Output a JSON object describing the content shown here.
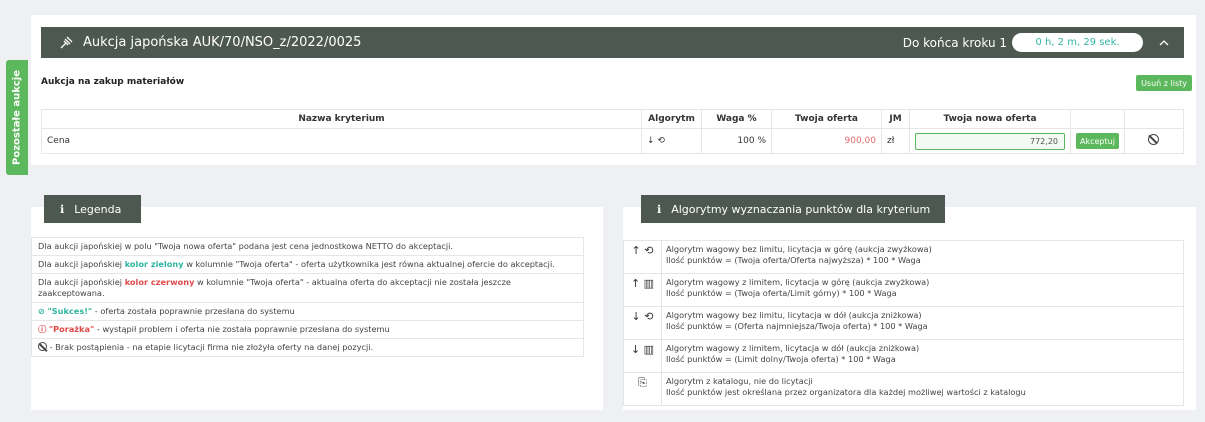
{
  "side_tab": {
    "label": "Pozostałe aukcje"
  },
  "auction": {
    "title": "Aukcja japońska AUK/70/NSO_z/2022/0025",
    "step_label": "Do końca kroku 1",
    "timer": "0 h, 2 m, 29 sek.",
    "subtitle": "Aukcja na zakup materiałów",
    "remove_button": "Usuń z listy",
    "table": {
      "headers": [
        "Nazwa kryterium",
        "Algorytm",
        "Waga %",
        "Twoja oferta",
        "JM",
        "Twoja nowa oferta"
      ],
      "row": {
        "name": "Cena",
        "algorithm_icon": "↓ ⟲",
        "weight": "100 %",
        "offer": "900,00",
        "unit": "zł",
        "new_offer": "772,20",
        "accept_button": "Akceptuj"
      }
    }
  },
  "legend": {
    "title": "Legenda",
    "items": {
      "i1": "Dla aukcji japońskiej w polu \"Twoja nowa oferta\" podana jest cena jednostkowa NETTO do akceptacji.",
      "i2_pre": "Dla aukcji japońskiej ",
      "i2_hl": "kolor zielony",
      "i2_post": " w kolumnie \"Twoja oferta\" - oferta użytkownika jest równa aktualnej ofercie do akceptacji.",
      "i3_pre": "Dla aukcji japońskiej ",
      "i3_hl": "kolor czerwony",
      "i3_post": " w kolumnie \"Twoja oferta\" - aktualna oferta do akceptacji nie została jeszcze zaakceptowana.",
      "i4_hl": "\"Sukces!\"",
      "i4_post": " - oferta została poprawnie przesłana do systemu",
      "i5_hl": "\"Porażka\"",
      "i5_post": " - wystąpił problem i oferta nie została poprawnie przesłana do systemu",
      "i6": " - Brak postąpienia - na etapie licytacji firma nie złożyła oferty na danej pozycji."
    }
  },
  "algorithms": {
    "title": "Algorytmy wyznaczania punktów dla kryterium",
    "items": [
      {
        "icon": "↑ ⟲",
        "line1": "Algorytm wagowy bez limitu, licytacja w górę (aukcja zwyżkowa)",
        "line2": "Ilość punktów = (Twoja oferta/Oferta najwyższa) * 100 * Waga"
      },
      {
        "icon": "↑ ▥",
        "line1": "Algorytm wagowy z limitem, licytacja w górę (aukcja zwyżkowa)",
        "line2": "Ilość punktów = (Twoja oferta/Limit górny) * 100 * Waga"
      },
      {
        "icon": "↓ ⟲",
        "line1": "Algorytm wagowy bez limitu, licytacja w dół (aukcja zniżkowa)",
        "line2": "Ilość punktów = (Oferta najmniejsza/Twoja oferta) * 100 * Waga"
      },
      {
        "icon": "↓ ▥",
        "line1": "Algorytm wagowy z limitem, licytacja w dół (aukcja zniżkowa)",
        "line2": "Ilość punktów = (Limit dolny/Twoja oferta) * 100 * Waga"
      },
      {
        "icon": "⎘",
        "line1": "Algorytm z katalogu, nie do licytacji",
        "line2": "Ilość punktów jest określana przez organizatora dla każdej możliwej wartości z katalogu"
      }
    ]
  }
}
